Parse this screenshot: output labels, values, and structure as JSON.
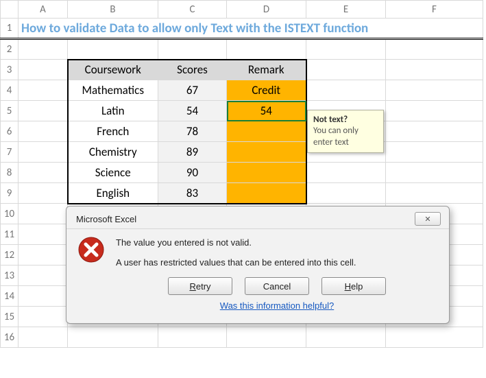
{
  "columns": [
    "A",
    "B",
    "C",
    "D",
    "E",
    "F"
  ],
  "rows": [
    "1",
    "2",
    "3",
    "4",
    "5",
    "6",
    "7",
    "8",
    "9",
    "10",
    "11",
    "12",
    "13",
    "14",
    "15",
    "16"
  ],
  "title": "How to validate Data to allow only Text with the ISTEXT function",
  "table": {
    "headers": {
      "coursework": "Coursework",
      "scores": "Scores",
      "remark": "Remark"
    },
    "rows": [
      {
        "name": "Mathematics",
        "score": "67",
        "remark": "Credit"
      },
      {
        "name": "Latin",
        "score": "54",
        "remark": "54"
      },
      {
        "name": "French",
        "score": "78",
        "remark": ""
      },
      {
        "name": "Chemistry",
        "score": "89",
        "remark": ""
      },
      {
        "name": "Science",
        "score": "90",
        "remark": ""
      },
      {
        "name": "English",
        "score": "83",
        "remark": ""
      }
    ]
  },
  "tooltip": {
    "title": "Not text?",
    "body1": "You can only",
    "body2": "enter text"
  },
  "dialog": {
    "title": "Microsoft Excel",
    "msg1": "The value you entered is not valid.",
    "msg2": "A user has restricted values that can be entered into this cell.",
    "buttons": {
      "retry": "Retry",
      "retry_ul": "R",
      "retry_rest": "etry",
      "cancel": "Cancel",
      "help": "Help",
      "help_ul": "H",
      "help_rest": "elp"
    },
    "link": "Was this information helpful?",
    "close": "✕"
  },
  "chart_data": {
    "type": "table",
    "title": "How to validate Data to allow only Text with the ISTEXT function",
    "columns": [
      "Coursework",
      "Scores",
      "Remark"
    ],
    "rows": [
      [
        "Mathematics",
        67,
        "Credit"
      ],
      [
        "Latin",
        54,
        54
      ],
      [
        "French",
        78,
        null
      ],
      [
        "Chemistry",
        89,
        null
      ],
      [
        "Science",
        90,
        null
      ],
      [
        "English",
        83,
        null
      ]
    ]
  }
}
